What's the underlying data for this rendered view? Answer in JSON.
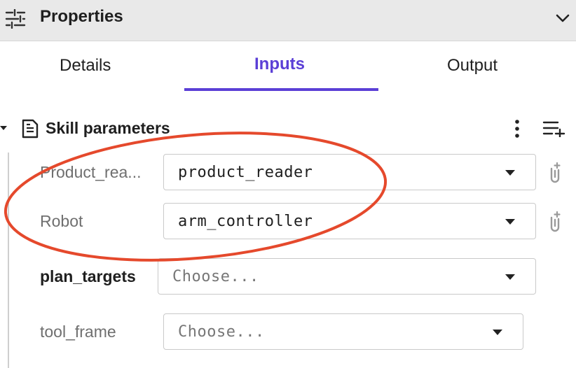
{
  "header": {
    "title": "Properties"
  },
  "tabs": [
    {
      "label": "Details"
    },
    {
      "label": "Inputs"
    },
    {
      "label": "Output"
    }
  ],
  "section": {
    "title": "Skill parameters"
  },
  "params": [
    {
      "label": "Product_rea...",
      "value": "product_reader"
    },
    {
      "label": "Robot",
      "value": "arm_controller"
    },
    {
      "label": "plan_targets",
      "value": "Choose..."
    },
    {
      "label": "tool_frame",
      "value": "Choose..."
    }
  ],
  "colors": {
    "accent": "#5b3fd6",
    "annotation": "#e5492c"
  },
  "icons": [
    "properties-icon",
    "chevron-down-icon",
    "document-icon",
    "more-vertical-icon",
    "add-list-icon",
    "link-clip-icon"
  ]
}
